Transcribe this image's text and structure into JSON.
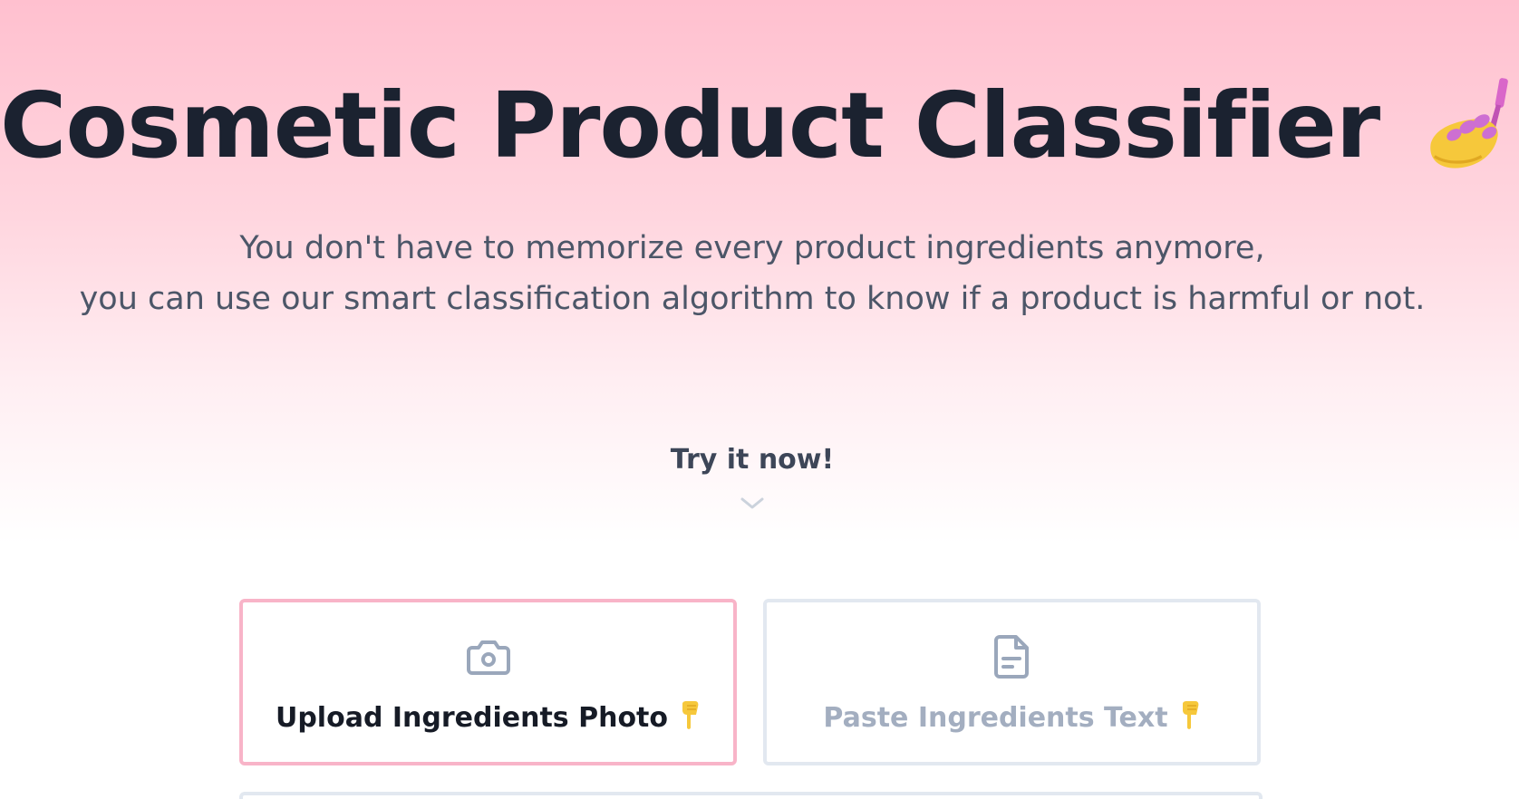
{
  "hero": {
    "title": "Cosmetic Product Classifier",
    "title_emoji": "nail-polish-icon",
    "subtitle_line1": "You don't have to memorize every product ingredients anymore,",
    "subtitle_line2": "you can use our smart classification algorithm to know if a product is harmful or not.",
    "cta": "Try it now!",
    "cta_icon": "chevron-down-icon"
  },
  "tabs": [
    {
      "label": "Upload Ingredients Photo",
      "icon": "camera-icon",
      "active": true
    },
    {
      "label": "Paste Ingredients Text",
      "icon": "document-icon",
      "active": false
    }
  ],
  "colors": {
    "gradient_top": "#ffc0cf",
    "title": "#1b2230",
    "subtitle": "#4c5668",
    "active_border": "#f8b4c8",
    "inactive_border": "#e2e8f0",
    "inactive_text": "#a3aec0"
  }
}
